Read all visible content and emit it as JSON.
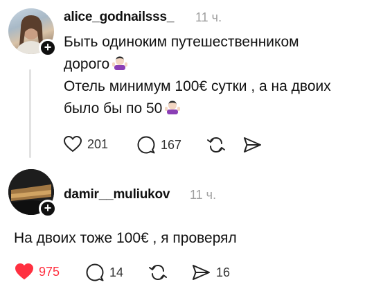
{
  "post1": {
    "username": "alice_godnailsss_",
    "time": "11 ч.",
    "lines": [
      "Быть одиноким путешественником",
      "дорого",
      "Отель минимум 100€ сутки , а на двоих",
      "было бы по 50"
    ],
    "likes": "201",
    "comments": "167",
    "liked": false
  },
  "post2": {
    "username": "damir__muliukov",
    "time": "11 ч.",
    "text": "На двоих тоже 100€ , я проверял",
    "likes": "975",
    "comments": "14",
    "shares": "16",
    "liked": true
  },
  "colors": {
    "like_active": "#ff3040",
    "muted": "#a0a0a0"
  },
  "icons": [
    "heart-icon",
    "comment-icon",
    "repost-icon",
    "share-icon",
    "plus-icon",
    "shrug-emoji"
  ]
}
